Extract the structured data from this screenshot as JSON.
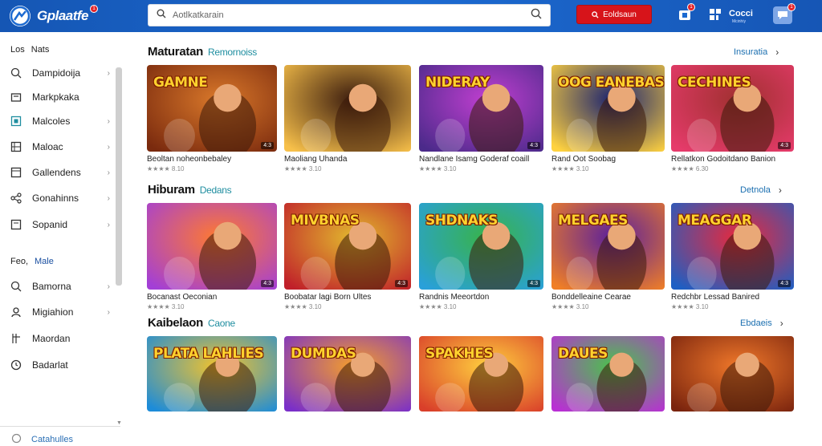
{
  "header": {
    "logo_text": "Gplaatfe",
    "logo_badge": "1",
    "search_placeholder": "Aotlkatkarain",
    "cta_label": "Eoldsaun",
    "user_label": "Cocci",
    "user_sub": "Mcinhiy",
    "notif_badges": [
      "1",
      "1",
      "1"
    ]
  },
  "sidebar": {
    "section1_head": "Los",
    "section1_accent": "Nats",
    "items1": [
      {
        "label": "Dampidoija",
        "icon": "search-icon",
        "chevron": true
      },
      {
        "label": "Markpkaka",
        "icon": "store-icon",
        "chevron": false
      },
      {
        "label": "Malcoles",
        "icon": "square-icon",
        "chevron": true
      },
      {
        "label": "Maloac",
        "icon": "grid-icon",
        "chevron": true
      },
      {
        "label": "Gallendens",
        "icon": "window-icon",
        "chevron": true
      },
      {
        "label": "Gonahinns",
        "icon": "share-icon",
        "chevron": true
      },
      {
        "label": "Sopanid",
        "icon": "box-icon",
        "chevron": true
      }
    ],
    "section2_head": "Feo,",
    "section2_accent": "Male",
    "items2": [
      {
        "label": "Bamorna",
        "icon": "search-icon",
        "chevron": true
      },
      {
        "label": "Migiahion",
        "icon": "user-icon",
        "chevron": true
      },
      {
        "label": "Maordan",
        "icon": "fork-icon",
        "chevron": false
      },
      {
        "label": "Badarlat",
        "icon": "clock-icon",
        "chevron": false
      }
    ],
    "footer_label": "Catahulles"
  },
  "sections": [
    {
      "title": "Maturatan",
      "subtitle": "Remornoiss",
      "see_all": "Insuratia",
      "cards": [
        {
          "art_title": "GAMNE",
          "caption": "Beoltan noheonbebaley",
          "meta": "★★★★ 8.10",
          "badge": "4:3"
        },
        {
          "art_title": "",
          "caption": "Maoliang Uhanda",
          "meta": "★★★★ 3.10",
          "badge": ""
        },
        {
          "art_title": "NIDERAY",
          "caption": "Nandlane Isamg Goderaf coaill",
          "meta": "★★★★ 3.10",
          "badge": "4:3"
        },
        {
          "art_title": "OOG EANEBAS",
          "caption": "Rand Oot Soobag",
          "meta": "★★★★ 3.10",
          "badge": ""
        },
        {
          "art_title": "CECHINES",
          "caption": "Rellatkon Godoitdano Banion",
          "meta": "★★★★ 6.30",
          "badge": "4:3"
        }
      ]
    },
    {
      "title": "Hiburam",
      "subtitle": "Dedans",
      "see_all": "Detnola",
      "cards": [
        {
          "art_title": "",
          "caption": "Bocanast Oeconian",
          "meta": "★★★★ 3.10",
          "badge": "4:3"
        },
        {
          "art_title": "MIVBNAS",
          "caption": "Boobatar lagi Born Ultes",
          "meta": "★★★★ 3.10",
          "badge": "4:3"
        },
        {
          "art_title": "SHDNAKS",
          "caption": "Randnis Meeortdon",
          "meta": "★★★★ 3.10",
          "badge": "4:3"
        },
        {
          "art_title": "MELGAES",
          "caption": "Bonddelleaine Cearae",
          "meta": "★★★★ 3.10",
          "badge": ""
        },
        {
          "art_title": "MEAGGAR",
          "caption": "Redchbr Lessad Banired",
          "meta": "★★★★ 3.10",
          "badge": "4:3"
        }
      ]
    },
    {
      "title": "Kaibelaon",
      "subtitle": "Caone",
      "see_all": "Ebdaeis",
      "cards": [
        {
          "art_title": "PLATA LAHLIES",
          "caption": "",
          "meta": "",
          "badge": ""
        },
        {
          "art_title": "DUMDAS",
          "caption": "",
          "meta": "",
          "badge": ""
        },
        {
          "art_title": "SPAKHES",
          "caption": "",
          "meta": "",
          "badge": ""
        },
        {
          "art_title": "DAUES",
          "caption": "",
          "meta": "",
          "badge": ""
        },
        {
          "art_title": "",
          "caption": "",
          "meta": "",
          "badge": ""
        }
      ]
    }
  ],
  "colors": {
    "header_blue": "#1c6ad1",
    "cta_red": "#d7141a",
    "accent_teal": "#1f8ea0"
  }
}
